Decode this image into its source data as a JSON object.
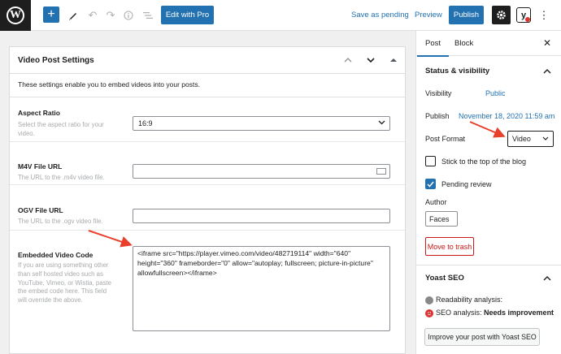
{
  "toolbar": {
    "logo_letter": "W",
    "add_symbol": "+",
    "edit_with_pro": "Edit with Pro",
    "save_as_pending": "Save as pending",
    "preview": "Preview",
    "publish": "Publish",
    "yoast_letter": "y"
  },
  "metabox": {
    "title": "Video Post Settings",
    "description": "These settings enable you to embed videos into your posts.",
    "aspect_ratio": {
      "label": "Aspect Ratio",
      "help": "Select the aspect ratio for your video.",
      "value": "16:9"
    },
    "m4v": {
      "label": "M4V File URL",
      "help": "The URL to the .m4v video file.",
      "value": ""
    },
    "ogv": {
      "label": "OGV File URL",
      "help": "The URL to the .ogv video file.",
      "value": ""
    },
    "embed": {
      "label": "Embedded Video Code",
      "help": "If you are using something other than self hosted video such as YouTube, Vimeo, or Wistia, paste the embed code here. This field will override the above.",
      "value": "<iframe src=\"https://player.vimeo.com/video/482719114\" width=\"640\" height=\"360\" frameborder=\"0\" allow=\"autoplay; fullscreen; picture-in-picture\" allowfullscreen></iframe>"
    }
  },
  "sidebar": {
    "tabs": [
      "Post",
      "Block"
    ],
    "status_title": "Status & visibility",
    "visibility_label": "Visibility",
    "visibility_value": "Public",
    "publish_label": "Publish",
    "publish_value": "November 18, 2020 11:59 am",
    "post_format_label": "Post Format",
    "post_format_value": "Video",
    "stick_label": "Stick to the top of the blog",
    "stick_checked": false,
    "pending_label": "Pending review",
    "pending_checked": true,
    "author_label": "Author",
    "author_value": "Faces",
    "trash_label": "Move to trash",
    "yoast_title": "Yoast SEO",
    "readability": "Readability analysis:",
    "seo_prefix": "SEO analysis: ",
    "seo_status": "Needs improvement",
    "yoast_button": "Improve your post with Yoast SEO"
  },
  "colors": {
    "accent": "#2271b1",
    "annotation_arrow": "#e8402a",
    "danger": "#cc1818"
  }
}
